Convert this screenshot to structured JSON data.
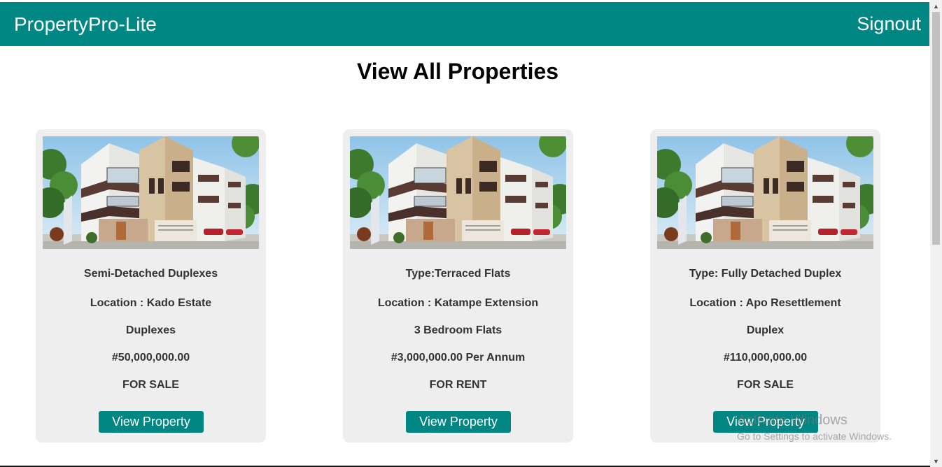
{
  "header": {
    "brand": "PropertyPro-Lite",
    "signout_label": "Signout"
  },
  "page": {
    "title": "View All Properties"
  },
  "properties": [
    {
      "type": "Semi-Detached Duplexes",
      "location": "Location : Kado Estate",
      "category": "Duplexes",
      "price": "#50,000,000.00",
      "status": "FOR SALE",
      "button_label": "View Property"
    },
    {
      "type": "Type:Terraced Flats",
      "location": "Location : Katampe Extension",
      "category": "3 Bedroom Flats",
      "price": "#3,000,000.00 Per Annum",
      "status": "FOR RENT",
      "button_label": "View Property"
    },
    {
      "type": "Type: Fully Detached Duplex",
      "location": "Location : Apo Resettlement",
      "category": "Duplex",
      "price": "#110,000,000.00",
      "status": "FOR SALE",
      "button_label": "View Property"
    }
  ],
  "system_watermark": {
    "line1": "Activate Windows",
    "line2": "Go to Settings to activate Windows."
  },
  "colors": {
    "accent": "#008683",
    "card_bg": "#eeeeee"
  }
}
